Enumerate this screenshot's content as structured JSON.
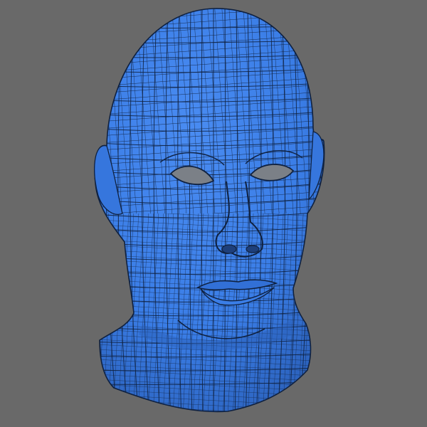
{
  "viewport": {
    "background_color": "#696969",
    "subject": "head-mesh",
    "mesh_fill_color": "#3a7de6",
    "mesh_shadow_color": "#2a5fb8",
    "wireframe_color": "#0f2140",
    "eye_socket_color": "#7b8087",
    "render_style": "wireframe-over-shaded"
  }
}
